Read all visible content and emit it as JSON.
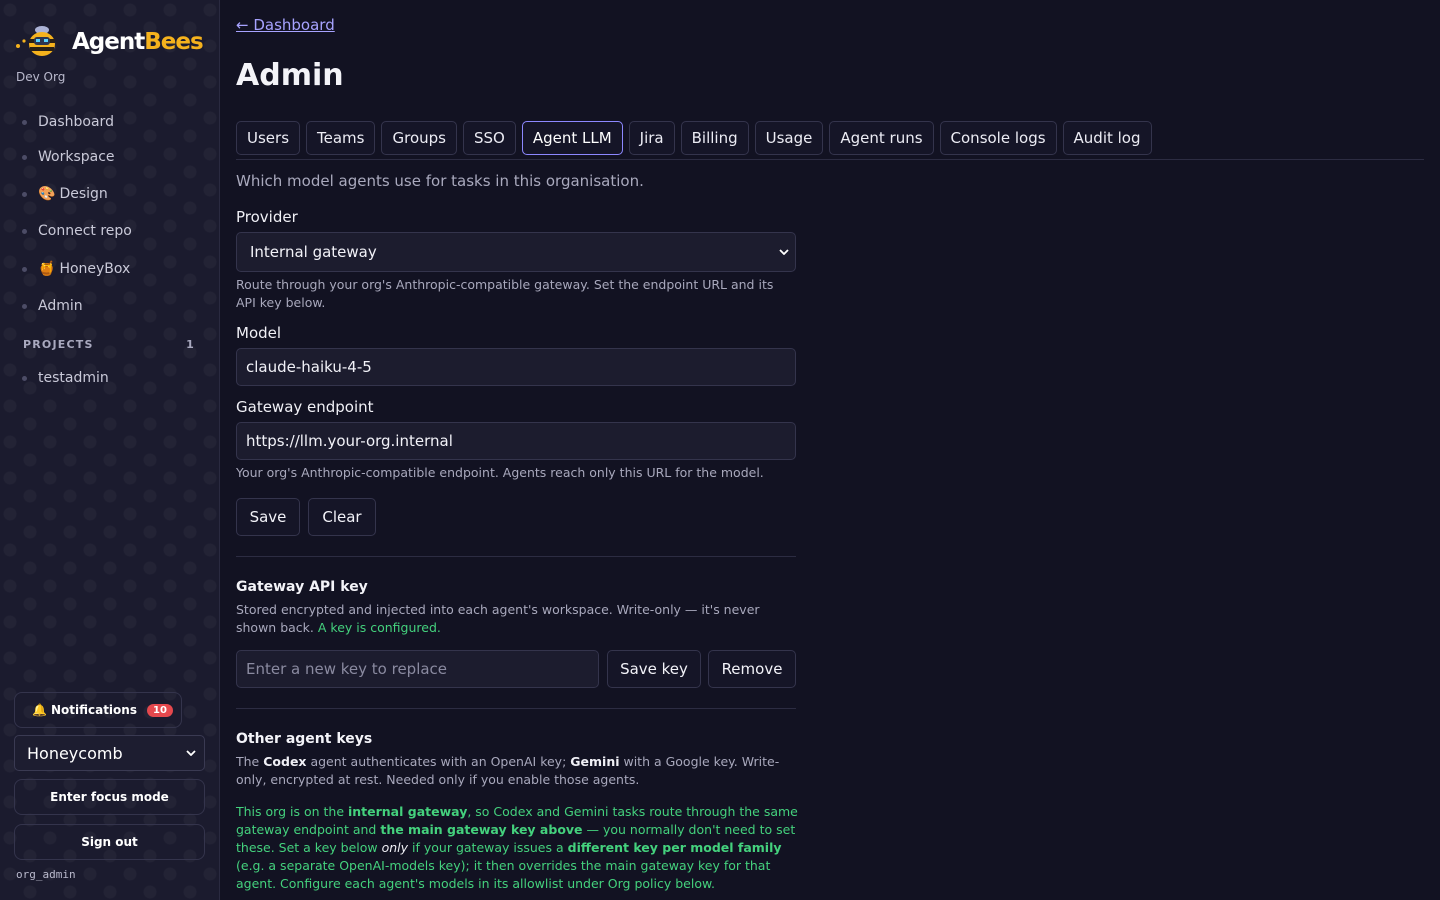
{
  "brand": {
    "name_part1": "Agent",
    "name_part2": "Bees",
    "org": "Dev Org"
  },
  "sidebar": {
    "nav": [
      {
        "label": "Dashboard",
        "emoji": ""
      },
      {
        "label": "Workspace",
        "emoji": ""
      },
      {
        "label": "Design",
        "emoji": "🎨"
      },
      {
        "label": "Connect repo",
        "emoji": ""
      },
      {
        "label": "HoneyBox",
        "emoji": "🍯"
      },
      {
        "label": "Admin",
        "emoji": ""
      }
    ],
    "projects_heading": "PROJECTS",
    "projects_count": "1",
    "projects": [
      "testadmin"
    ],
    "notifications_label": "Notifications",
    "notifications_count": "10",
    "team_select": "Honeycomb",
    "focus_button": "Enter focus mode",
    "signout_button": "Sign out",
    "username": "org_admin"
  },
  "main": {
    "back_link": "← Dashboard",
    "title": "Admin",
    "tabs": [
      "Users",
      "Teams",
      "Groups",
      "SSO",
      "Agent LLM",
      "Jira",
      "Billing",
      "Usage",
      "Agent runs",
      "Console logs",
      "Audit log"
    ],
    "active_tab": "Agent LLM",
    "intro": "Which model agents use for tasks in this organisation.",
    "provider_label": "Provider",
    "provider_value": "Internal gateway",
    "provider_help": "Route through your org's Anthropic-compatible gateway. Set the endpoint URL and its API key below.",
    "model_label": "Model",
    "model_value": "claude-haiku-4-5",
    "endpoint_label": "Gateway endpoint",
    "endpoint_value": "https://llm.your-org.internal",
    "endpoint_help": "Your org's Anthropic-compatible endpoint. Agents reach only this URL for the model.",
    "save_button": "Save",
    "clear_button": "Clear",
    "api_key_title": "Gateway API key",
    "api_key_help": "Stored encrypted and injected into each agent's workspace. Write-only — it's never shown back.",
    "api_key_status": "A key is configured.",
    "api_key_placeholder": "Enter a new key to replace",
    "save_key_button": "Save key",
    "remove_button": "Remove",
    "other_title": "Other agent keys",
    "other_help": {
      "t1": "The ",
      "b1": "Codex",
      "t2": " agent authenticates with an OpenAI key; ",
      "b2": "Gemini",
      "t3": " with a Google key. Write-only, encrypted at rest. Needed only if you enable those agents."
    },
    "note": {
      "t1": "This org is on the ",
      "b1": "internal gateway",
      "t2": ", so Codex and Gemini tasks route through the same gateway endpoint and ",
      "b2": "the main gateway key above",
      "t3": " — you normally don't need to set these. Set a key below ",
      "i1": "only",
      "t4": " if your gateway issues a ",
      "b3": "different key per model family",
      "t5": " (e.g. a separate OpenAI-models key); it then overrides the main gateway key for that agent. Configure each agent's models in its allowlist under Org policy below."
    }
  },
  "colors": {
    "accent": "#8d88ff",
    "brand_yellow": "#f5b21d",
    "success": "#44d17d",
    "badge": "#e5484d"
  }
}
